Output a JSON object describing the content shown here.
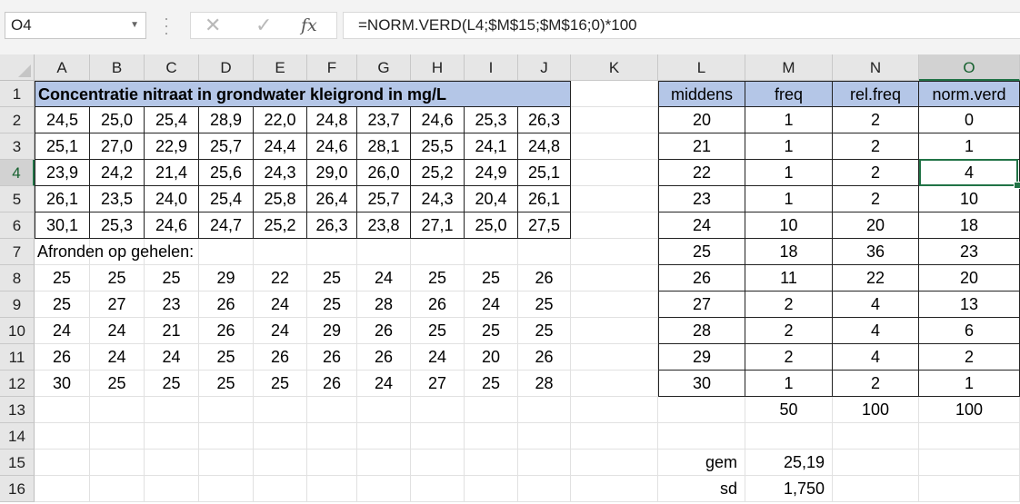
{
  "namebox": "O4",
  "formula": "=NORM.VERD(L4;$M$15;$M$16;0)*100",
  "icons": {
    "namebox_dropdown": "chevron-down-icon",
    "cancel": "close-icon",
    "enter": "check-icon",
    "fx": "function-icon"
  },
  "columns": [
    "A",
    "B",
    "C",
    "D",
    "E",
    "F",
    "G",
    "H",
    "I",
    "J",
    "K",
    "L",
    "M",
    "N",
    "O"
  ],
  "rows": [
    "1",
    "2",
    "3",
    "4",
    "5",
    "6",
    "7",
    "8",
    "9",
    "10",
    "11",
    "12",
    "13",
    "14",
    "15",
    "16"
  ],
  "active_cell": {
    "column": "O",
    "row": "4"
  },
  "title": "Concentratie nitraat in grondwater kleigrond in mg/L",
  "raw_data": [
    [
      "24,5",
      "25,0",
      "25,4",
      "28,9",
      "22,0",
      "24,8",
      "23,7",
      "24,6",
      "25,3",
      "26,3"
    ],
    [
      "25,1",
      "27,0",
      "22,9",
      "25,7",
      "24,4",
      "24,6",
      "28,1",
      "25,5",
      "24,1",
      "24,8"
    ],
    [
      "23,9",
      "24,2",
      "21,4",
      "25,6",
      "24,3",
      "29,0",
      "26,0",
      "25,2",
      "24,9",
      "25,1"
    ],
    [
      "26,1",
      "23,5",
      "24,0",
      "25,4",
      "25,8",
      "26,4",
      "25,7",
      "24,3",
      "20,4",
      "26,1"
    ],
    [
      "30,1",
      "25,3",
      "24,6",
      "24,7",
      "25,2",
      "26,3",
      "23,8",
      "27,1",
      "25,0",
      "27,5"
    ]
  ],
  "round_label": "Afronden op gehelen:",
  "rounded_data": [
    [
      "25",
      "25",
      "25",
      "29",
      "22",
      "25",
      "24",
      "25",
      "25",
      "26"
    ],
    [
      "25",
      "27",
      "23",
      "26",
      "24",
      "25",
      "28",
      "26",
      "24",
      "25"
    ],
    [
      "24",
      "24",
      "21",
      "26",
      "24",
      "29",
      "26",
      "25",
      "25",
      "25"
    ],
    [
      "26",
      "24",
      "24",
      "25",
      "26",
      "26",
      "26",
      "24",
      "20",
      "26"
    ],
    [
      "30",
      "25",
      "25",
      "25",
      "25",
      "26",
      "24",
      "27",
      "25",
      "28"
    ]
  ],
  "freq_headers": [
    "middens",
    "freq",
    "rel.freq",
    "norm.verd"
  ],
  "freq_table": [
    [
      "20",
      "1",
      "2",
      "0"
    ],
    [
      "21",
      "1",
      "2",
      "1"
    ],
    [
      "22",
      "1",
      "2",
      "4"
    ],
    [
      "23",
      "1",
      "2",
      "10"
    ],
    [
      "24",
      "10",
      "20",
      "18"
    ],
    [
      "25",
      "18",
      "36",
      "23"
    ],
    [
      "26",
      "11",
      "22",
      "20"
    ],
    [
      "27",
      "2",
      "4",
      "13"
    ],
    [
      "28",
      "2",
      "4",
      "6"
    ],
    [
      "29",
      "2",
      "4",
      "2"
    ],
    [
      "30",
      "1",
      "2",
      "1"
    ]
  ],
  "totals": {
    "freq": "50",
    "rel_freq": "100",
    "norm_verd": "100"
  },
  "stats": {
    "gem_label": "gem",
    "gem_value": "25,19",
    "sd_label": "sd",
    "sd_value": "1,750"
  }
}
